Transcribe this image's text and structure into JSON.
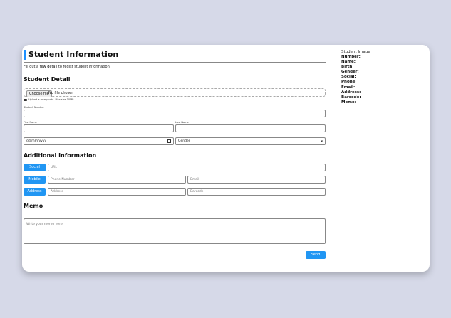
{
  "header": {
    "title": "Student Information",
    "subtitle": "Fill out a few detail to regist student information"
  },
  "student_detail": {
    "heading": "Student Detail",
    "file_button": "Choose file",
    "file_status": "No file chosen",
    "upload_hint": "Upload a face photo. Max size 10MB",
    "student_number_label": "Student Number",
    "first_name_label": "First Name",
    "last_name_label": "Last Name",
    "birth_placeholder": "dd/mm/yyyy",
    "gender_selected": "Gender"
  },
  "additional": {
    "heading": "Additional Information",
    "social_tag": "Social",
    "url_placeholder": "URL",
    "mobile_tag": "Mobile",
    "phone_placeholder": "Phone Number",
    "email_placeholder": "Email",
    "address_tag": "Address",
    "address_placeholder": "Address",
    "barcode_placeholder": "Barcode"
  },
  "memo": {
    "heading": "Memo",
    "placeholder": "Write your memo here",
    "send_label": "Send"
  },
  "sidebar": {
    "image_alt": "Student Image",
    "fields": [
      "Number:",
      "Name:",
      "Birth:",
      "Gender:",
      "Social:",
      "Phone:",
      "Email:",
      "Address:",
      "Barcode:",
      "Memo:"
    ]
  },
  "colors": {
    "accent": "#2196f3",
    "background": "#d6d9e8"
  }
}
